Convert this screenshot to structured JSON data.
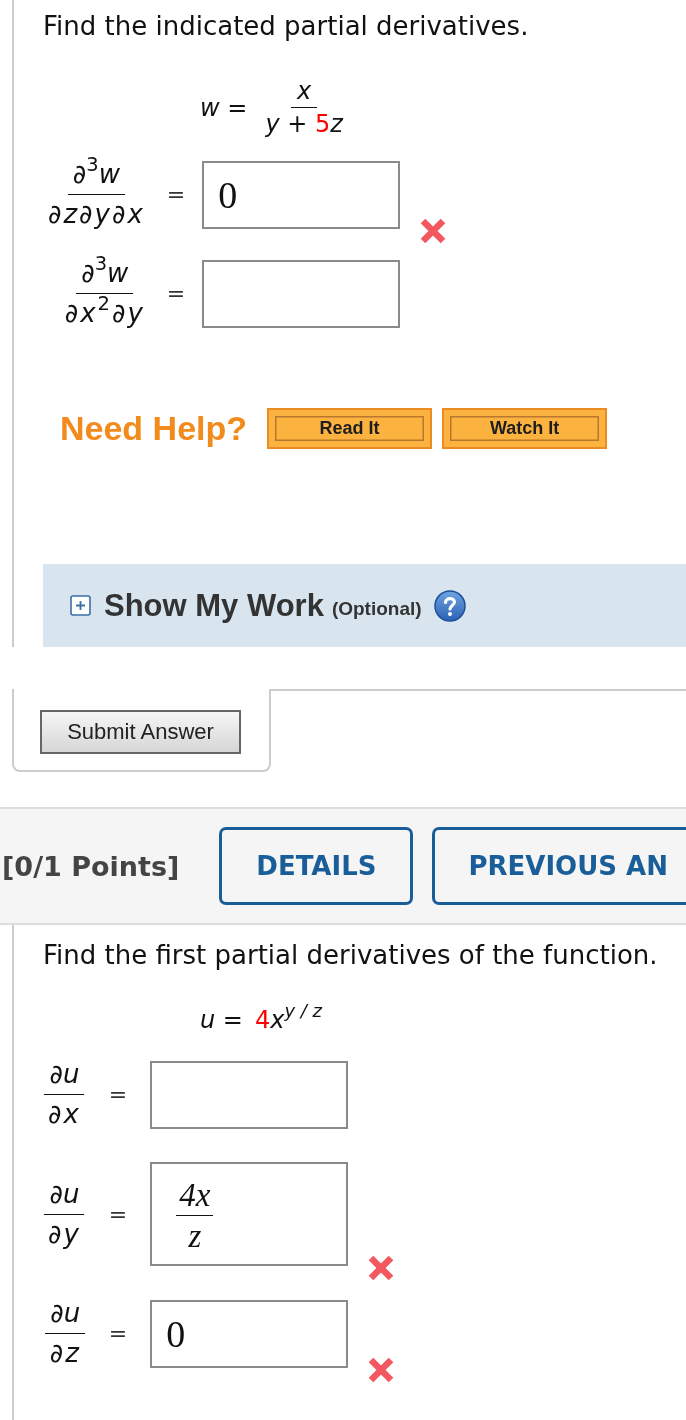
{
  "question_1": {
    "prompt": "Find the indicated partial derivatives.",
    "function": {
      "kind": "fraction",
      "lhs": "*w* =",
      "numerator": [
        {
          "text": "*x*"
        }
      ],
      "denominator": [
        {
          "text": "*y* + "
        },
        {
          "text": "5",
          "color": "#ff0000"
        },
        {
          "text": "*z*"
        }
      ]
    },
    "answers": [
      {
        "derivative": {
          "numerator": "∂$^{3}$*w*",
          "denominator": "∂*z*∂*y*∂*x*"
        },
        "relation": "=",
        "answer": {
          "kind": "text",
          "value": "0"
        },
        "incorrect": true
      },
      {
        "derivative": {
          "numerator": "∂$^{3}$*w*",
          "denominator": "∂*x*$^{2}$∂*y*"
        },
        "relation": "=",
        "answer": {
          "kind": "empty"
        },
        "incorrect": false
      }
    ],
    "help": {
      "label": "Need Help?",
      "buttons": [
        "Read It",
        "Watch It"
      ]
    },
    "show_my_work": {
      "label": "Show My Work",
      "note": "(Optional)",
      "expanded": false
    },
    "submit_button": "Submit Answer"
  },
  "question_2": {
    "points": "[0/1 Points]",
    "buttons": [
      "DETAILS",
      "PREVIOUS AN"
    ],
    "prompt": "Find the first partial derivatives of the function.",
    "function": {
      "kind": "inline",
      "lhs": "*u* =",
      "terms": [
        {
          "text": "4",
          "color": "#ff0000"
        },
        {
          "text": "*x*$^{y / z}$"
        }
      ]
    },
    "answers": [
      {
        "derivative": {
          "numerator": "∂*u*",
          "denominator": "∂*x*"
        },
        "relation": "=",
        "answer": {
          "kind": "empty"
        },
        "incorrect": false
      },
      {
        "derivative": {
          "numerator": "∂*u*",
          "denominator": "∂*y*"
        },
        "relation": "=",
        "answer": {
          "kind": "fraction",
          "numerator": "4x",
          "denominator": "z"
        },
        "incorrect": true
      },
      {
        "derivative": {
          "numerator": "∂*u*",
          "denominator": "∂*z*"
        },
        "relation": "=",
        "answer": {
          "kind": "text",
          "value": "0"
        },
        "incorrect": true
      }
    ]
  }
}
